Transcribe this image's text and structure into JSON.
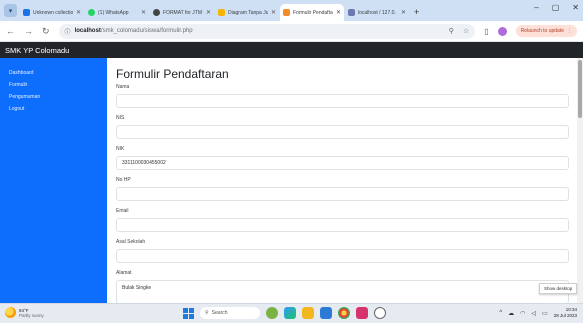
{
  "browser": {
    "tabs": [
      {
        "label": "Unknown collection",
        "icon": "collection-icon",
        "color": "#1a73e8"
      },
      {
        "label": "(1) WhatsApp",
        "icon": "whatsapp-icon",
        "color": "#25d366"
      },
      {
        "label": "FORMAT for JTM",
        "icon": "doc-icon",
        "color": "#444444"
      },
      {
        "label": "Diagram Tanpa Ju",
        "icon": "drive-icon",
        "color": "#f4b400"
      },
      {
        "label": "Formulir Pendafta",
        "icon": "form-icon",
        "color": "#f28b2a",
        "active": true
      },
      {
        "label": "localhost / 127.0.",
        "icon": "phpmyadmin-icon",
        "color": "#6c78af"
      }
    ],
    "new_tab": "+",
    "window_controls": {
      "minimize": "–",
      "maximize": "▢",
      "close": "✕"
    },
    "address": {
      "host": "localhost",
      "path": "/smk_colomadu/siswa/formulir.php"
    },
    "relaunch_label": "Relaunch to update"
  },
  "app": {
    "brand": "SMK YP Colomadu",
    "sidebar": [
      {
        "label": "Dashboard"
      },
      {
        "label": "Formulir"
      },
      {
        "label": "Pengumuman"
      },
      {
        "label": "Logout"
      }
    ],
    "form": {
      "title": "Formulir Pendaftaran",
      "fields": [
        {
          "label": "Nama",
          "value": ""
        },
        {
          "label": "NIS",
          "value": ""
        },
        {
          "label": "NIK",
          "value": "3311100030455002"
        },
        {
          "label": "No HP",
          "value": ""
        },
        {
          "label": "Email",
          "value": ""
        },
        {
          "label": "Asal Sekolah",
          "value": ""
        },
        {
          "label": "Alamat",
          "value": "Bulak Singke"
        }
      ]
    }
  },
  "tooltip": {
    "show_desktop": "Show desktop"
  },
  "taskbar": {
    "weather_temp": "84°F",
    "weather_desc": "Partly sunny",
    "search_label": "Search",
    "time": "10:34",
    "date": "28 Jul 2023"
  }
}
